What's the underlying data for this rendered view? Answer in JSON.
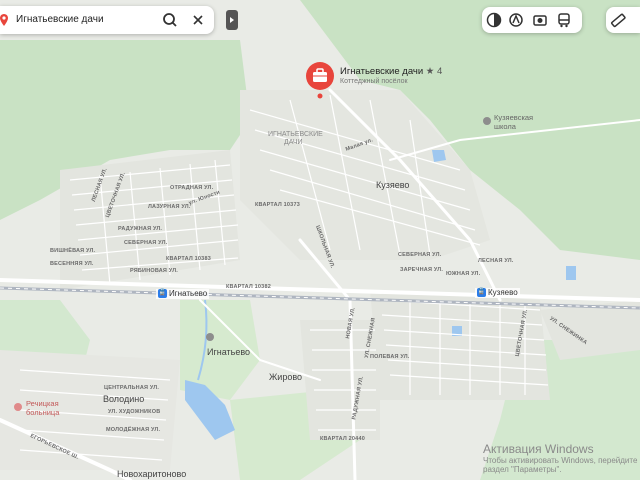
{
  "search": {
    "query": "Игнатьевские дачи"
  },
  "poi": {
    "name": "Игнатьевские дачи",
    "rating": "★ 4",
    "category": "Коттеджный посёлок"
  },
  "stations": [
    {
      "name": "Игнатьево"
    },
    {
      "name": "Кузяево"
    }
  ],
  "places": {
    "kuzyaevo": "Кузяево",
    "ignatyevo": "Игнатьево",
    "zhirovo": "Жирово",
    "volodino": "Володино",
    "novokharitonovo": "Новохаритоново",
    "ignat_dachi_line1": "ИГНАТЬЕВСКИЕ",
    "ignat_dachi_line2": "ДАЧИ",
    "school_line1": "Кузяевская",
    "school_line2": "школа",
    "hospital_line1": "Речицкая",
    "hospital_line2": "больница"
  },
  "streets": {
    "malaya": "Малая ул.",
    "kvartal_10373": "КВАРТАЛ 10373",
    "kvartal_10383": "КВАРТАЛ 10383",
    "kvartal_10382": "КВАРТАЛ 10382",
    "kvartal_20440": "КВАРТАЛ 20440",
    "yunosti": "ул. Юности",
    "raduzhnaya": "РАДУЖНАЯ УЛ.",
    "severnaya": "СЕВЕРНАЯ УЛ.",
    "vishnevaya": "ВИШНЁВАЯ УЛ.",
    "vesennyaya": "ВЕСЕННЯЯ УЛ.",
    "ryabinovaya": "РЯБИНОВАЯ УЛ.",
    "lazurnaya": "ЛАЗУРНАЯ УЛ.",
    "otradnaya": "ОТРАДНАЯ УЛ.",
    "tsvetochnaya": "ЦВЕТОЧНАЯ УЛ.",
    "lesnaya_w": "ЛЕСНАЯ УЛ.",
    "shkolnaya": "ШКОЛЬНАЯ УЛ.",
    "severnaya_e": "СЕВЕРНАЯ УЛ.",
    "zarechnaya": "ЗАРЕЧНАЯ УЛ.",
    "yuzhnaya": "ЮЖНАЯ УЛ.",
    "lesnaya_e": "ЛЕСНАЯ УЛ.",
    "novaya": "НОВАЯ УЛ.",
    "snezhnaya": "УЛ. СНЕЖНАЯ",
    "tsvetochnaya_e": "ЦВЕТОЧНАЯ УЛ.",
    "snezhinka": "УЛ. СНЕЖИНКА",
    "polevaya": "ПОЛЕВАЯ УЛ.",
    "raduzhnaya_s": "РАДУЖНАЯ УЛ.",
    "tsentralnaya": "ЦЕНТРАЛЬНАЯ УЛ.",
    "khudozhnikov": "УЛ. ХУДОЖНИКОВ",
    "molodezhnaya": "МОЛОДЁЖНАЯ УЛ.",
    "egoryevskoe": "ЕГОРЬЕВСКОЕ Ш."
  },
  "watermark": {
    "line1": "Активация Windows",
    "line2": "Чтобы активировать Windows, перейдите",
    "line3": "раздел \"Параметры\"."
  },
  "colors": {
    "forest": "#c6e0c2",
    "residential": "#e7e9e4",
    "water": "#9cc6f0",
    "accent": "#e8453c",
    "rail": "#a9b0bb"
  }
}
